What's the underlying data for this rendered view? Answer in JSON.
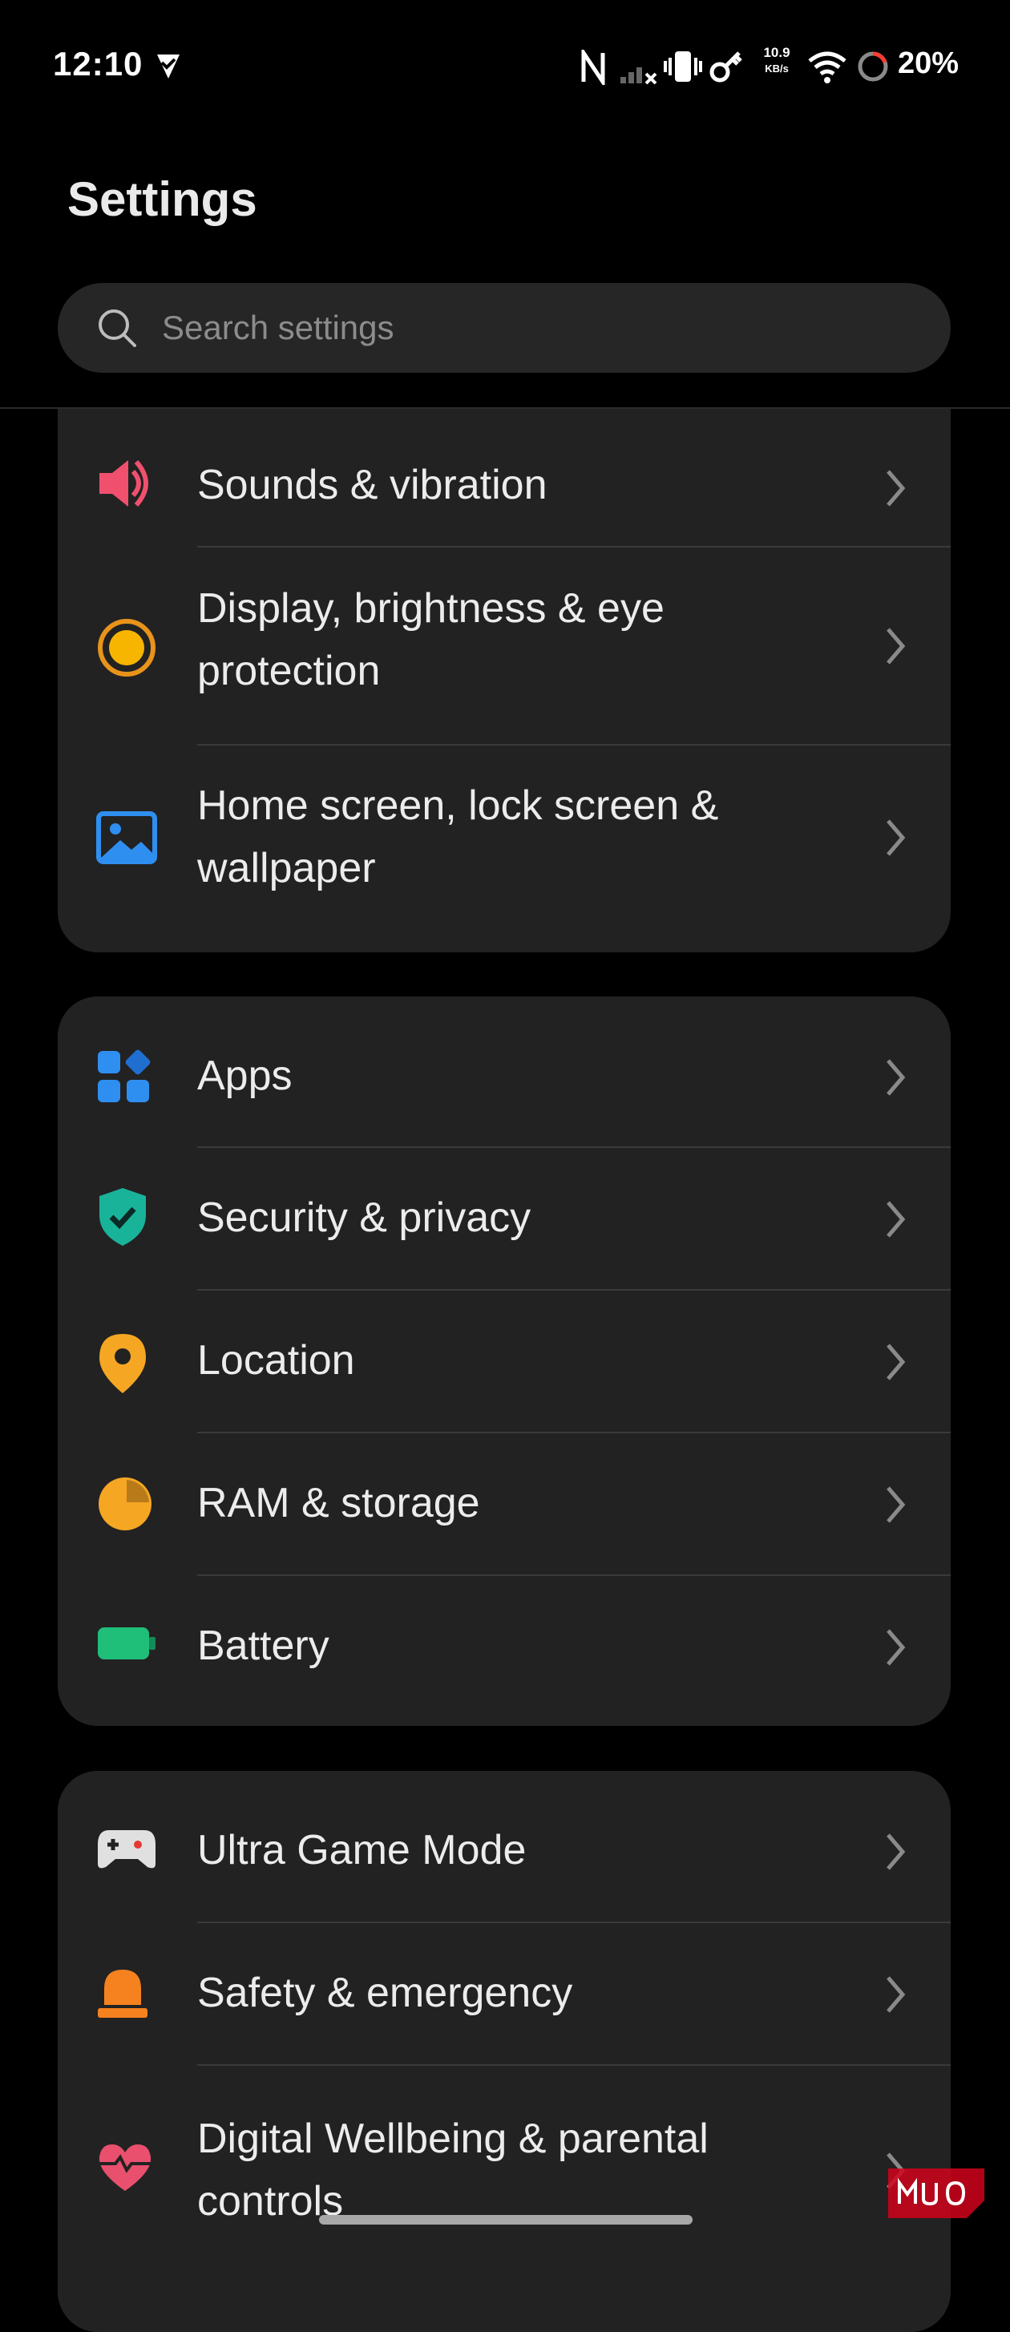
{
  "status_bar": {
    "time": "12:10",
    "net_speed_value": "10.9",
    "net_speed_unit": "KB/s",
    "battery_percent": "20%"
  },
  "header": {
    "title": "Settings",
    "search_placeholder": "Search settings"
  },
  "groups": [
    {
      "items": [
        {
          "label": "Sounds & vibration",
          "icon": "speaker-icon",
          "color": "#f0506e"
        },
        {
          "label": "Display, brightness & eye protection",
          "icon": "brightness-icon",
          "color": "#f5a623"
        },
        {
          "label": "Home screen, lock screen & wallpaper",
          "icon": "wallpaper-icon",
          "color": "#2f8ff0"
        }
      ]
    },
    {
      "items": [
        {
          "label": "Apps",
          "icon": "apps-icon",
          "color": "#2f8ff0"
        },
        {
          "label": "Security & privacy",
          "icon": "shield-check-icon",
          "color": "#19b39a"
        },
        {
          "label": "Location",
          "icon": "location-pin-icon",
          "color": "#f5a623"
        },
        {
          "label": "RAM & storage",
          "icon": "pie-chart-icon",
          "color": "#f5a623"
        },
        {
          "label": "Battery",
          "icon": "battery-icon",
          "color": "#1fbf7a"
        }
      ]
    },
    {
      "items": [
        {
          "label": "Ultra Game Mode",
          "icon": "gamepad-icon",
          "color": "#e0e0e0"
        },
        {
          "label": "Safety & emergency",
          "icon": "siren-icon",
          "color": "#f5821f"
        },
        {
          "label": "Digital Wellbeing & parental controls",
          "icon": "heart-icon",
          "color": "#e8506e"
        }
      ]
    }
  ]
}
